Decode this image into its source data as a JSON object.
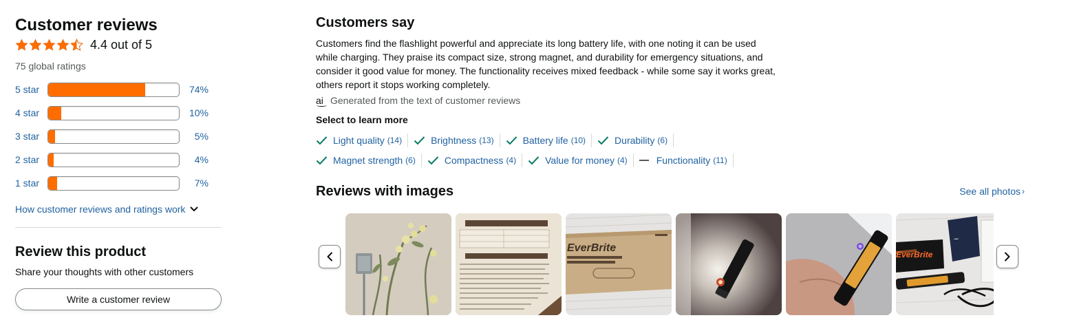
{
  "customer_reviews": {
    "title": "Customer reviews",
    "average_text": "4.4 out of 5",
    "average_value": 4.4,
    "global_ratings": "75 global ratings",
    "histogram": [
      {
        "label": "5 star",
        "percent_text": "74%",
        "percent": 74
      },
      {
        "label": "4 star",
        "percent_text": "10%",
        "percent": 10
      },
      {
        "label": "3 star",
        "percent_text": "5%",
        "percent": 5
      },
      {
        "label": "2 star",
        "percent_text": "4%",
        "percent": 4
      },
      {
        "label": "1 star",
        "percent_text": "7%",
        "percent": 7
      }
    ],
    "how_link": "How customer reviews and ratings work"
  },
  "review_product": {
    "title": "Review this product",
    "subtitle": "Share your thoughts with other customers",
    "button_label": "Write a customer review"
  },
  "customers_say": {
    "title": "Customers say",
    "summary": "Customers find the flashlight powerful and appreciate its long battery life, with one noting it can be used while charging. They praise its compact size, strong magnet, and durability for emergency situations, and consider it good value for money. The functionality receives mixed feedback - while some say it works great, others report it stops working completely.",
    "ai_icon_text": "ai",
    "ai_note": "Generated from the text of customer reviews",
    "learn_more": "Select to learn more",
    "aspects_row1": [
      {
        "label": "Light quality",
        "count": "(14)",
        "sentiment": "positive"
      },
      {
        "label": "Brightness",
        "count": "(13)",
        "sentiment": "positive"
      },
      {
        "label": "Battery life",
        "count": "(10)",
        "sentiment": "positive"
      },
      {
        "label": "Durability",
        "count": "(6)",
        "sentiment": "positive"
      }
    ],
    "aspects_row2": [
      {
        "label": "Magnet strength",
        "count": "(6)",
        "sentiment": "positive"
      },
      {
        "label": "Compactness",
        "count": "(4)",
        "sentiment": "positive"
      },
      {
        "label": "Value for money",
        "count": "(4)",
        "sentiment": "positive"
      },
      {
        "label": "Functionality",
        "count": "(11)",
        "sentiment": "mixed"
      }
    ]
  },
  "reviews_with_images": {
    "title": "Reviews with images",
    "see_all": "See all photos",
    "see_all_chevron": "›",
    "images": [
      {
        "name": "review-image-plant-wall"
      },
      {
        "name": "review-image-manual"
      },
      {
        "name": "review-image-box",
        "text": "EverBrite"
      },
      {
        "name": "review-image-lit-flashlight"
      },
      {
        "name": "review-image-hand-flashlight"
      },
      {
        "name": "review-image-package-contents",
        "text": "EverBrite"
      }
    ]
  },
  "colors": {
    "star": "#ff6d00",
    "bar_fill": "#ff6d00",
    "link": "#2162a1",
    "check": "#067d62",
    "text": "#0f1111",
    "muted": "#565959"
  },
  "icons": [
    "star-icon",
    "half-star-icon",
    "chevron-down-icon",
    "ai-icon",
    "checkmark-icon",
    "dash-icon",
    "chevron-left-icon",
    "chevron-right-icon"
  ]
}
